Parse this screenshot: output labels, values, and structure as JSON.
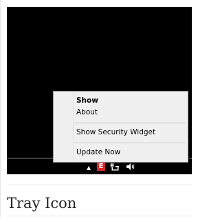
{
  "caption": "Tray Icon",
  "menu": {
    "items": [
      {
        "label": "Show",
        "bold": true
      },
      {
        "label": "About",
        "bold": false
      },
      {
        "label": "Show Security Widget",
        "bold": false
      },
      {
        "label": "Update Now",
        "bold": false
      }
    ]
  },
  "tray": {
    "overflow_arrow": "▲",
    "app_icon_letter": "E",
    "app_icon_color": "#d8262a",
    "icons": [
      "tray-overflow-arrow-icon",
      "security-app-tray-icon",
      "network-icon",
      "volume-icon"
    ]
  }
}
